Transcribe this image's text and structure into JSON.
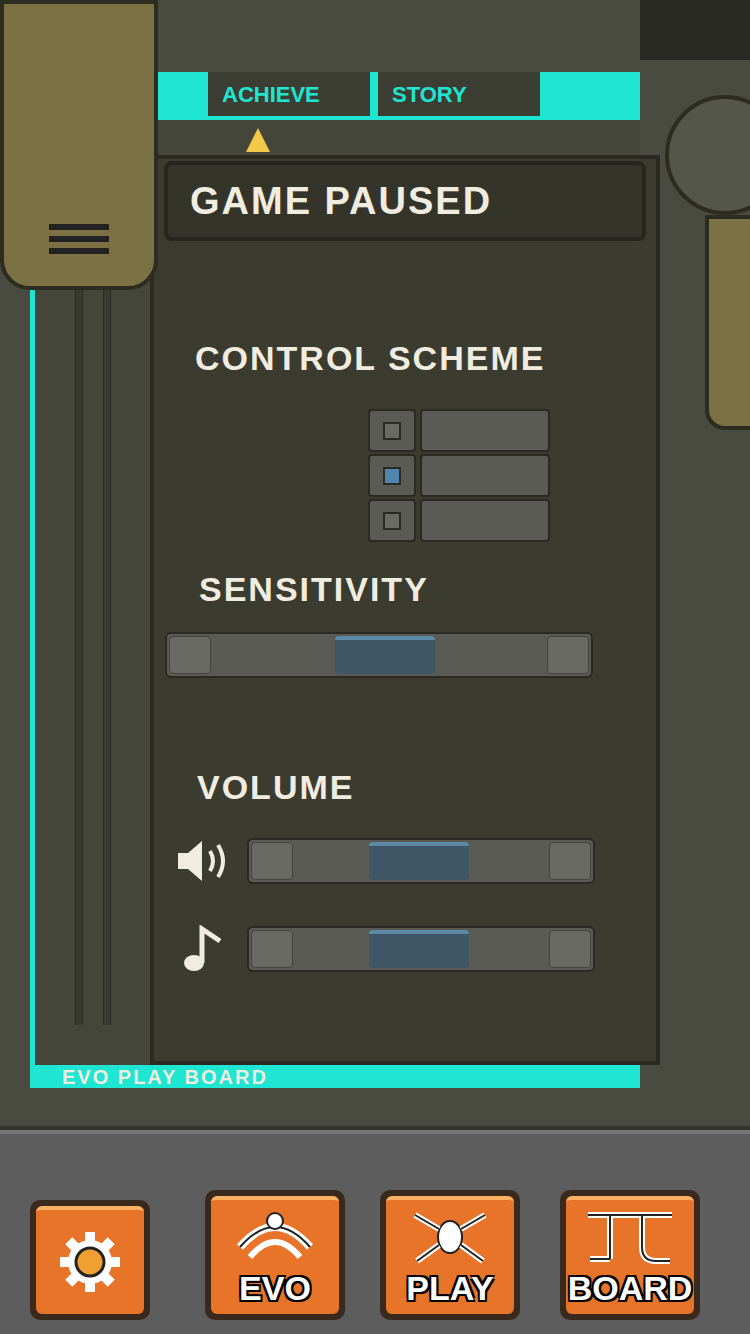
{
  "tabs": [
    {
      "label": "ACHIEVE",
      "selected": true
    },
    {
      "label": "STORY",
      "selected": false
    }
  ],
  "panel": {
    "title": "GAME PAUSED",
    "control_scheme": {
      "label": "CONTROL SCHEME",
      "options": [
        {
          "selected": false
        },
        {
          "selected": true
        },
        {
          "selected": false
        }
      ]
    },
    "sensitivity": {
      "label": "SENSITIVITY",
      "level": 0.5
    },
    "volume": {
      "label": "VOLUME",
      "channels": [
        {
          "kind": "sound",
          "level": 0.45
        },
        {
          "kind": "music",
          "level": 0.45
        }
      ]
    }
  },
  "footer_label": "EVO PLAY BOARD",
  "nav": [
    {
      "kind": "settings"
    },
    {
      "kind": "evo",
      "label": "EVO"
    },
    {
      "kind": "play",
      "label": "PLAY"
    },
    {
      "kind": "board",
      "label": "BOARD"
    }
  ]
}
